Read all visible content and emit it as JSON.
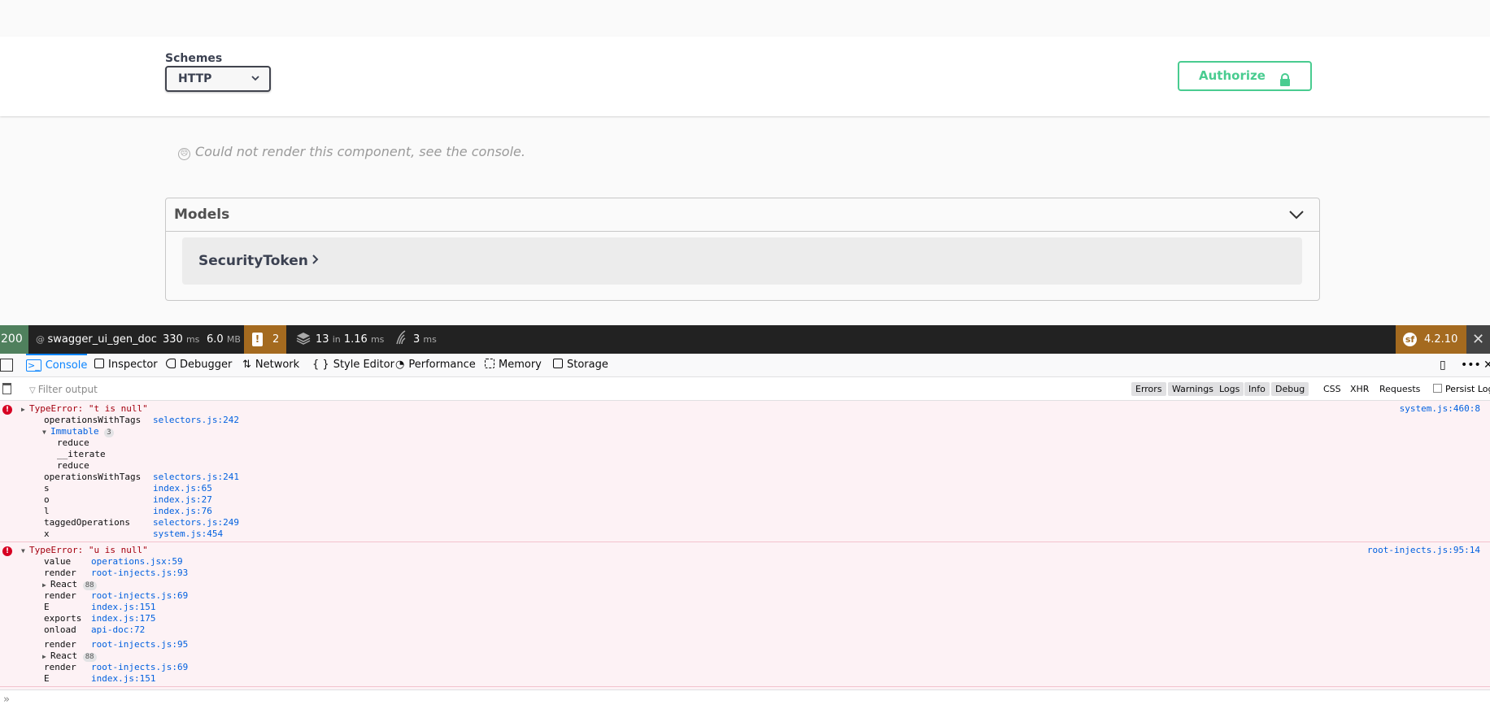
{
  "swagger": {
    "schemes_label": "Schemes",
    "scheme_selected": "HTTP",
    "authorize_label": "Authorize",
    "error_message": "Could not render this component, see the console.",
    "models_title": "Models",
    "model_name": "SecurityToken"
  },
  "symfony_toolbar": {
    "status_code": "200",
    "route": "swagger_ui_gen_doc",
    "time_value": "330",
    "time_unit": "ms",
    "memory_value": "6.0",
    "memory_unit": "MB",
    "warnings_count": "2",
    "db_queries": "13",
    "db_in": "in",
    "db_time": "1.16",
    "db_unit": "ms",
    "twig_time": "3",
    "twig_unit": "ms",
    "version": "4.2.10"
  },
  "devtools": {
    "tabs": [
      "Console",
      "Inspector",
      "Debugger",
      "Network",
      "Style Editor",
      "Performance",
      "Memory",
      "Storage"
    ],
    "filter_placeholder": "Filter output",
    "filter_buttons": [
      "Errors",
      "Warnings",
      "Logs",
      "Info",
      "Debug"
    ],
    "filter_text": [
      "CSS",
      "XHR",
      "Requests"
    ],
    "persist_label": "Persist Logs"
  },
  "console": {
    "error1": {
      "message": "TypeError: \"t is null\"",
      "source": "system.js:460:8",
      "stack": [
        {
          "fn": "operationsWithTags",
          "loc": "selectors.js:242"
        }
      ],
      "immutable_label": "Immutable",
      "immutable_count": "3",
      "immutable_items": [
        "reduce",
        "__iterate",
        "reduce"
      ],
      "stack2": [
        {
          "fn": "operationsWithTags",
          "loc": "selectors.js:241"
        },
        {
          "fn": "s",
          "loc": "index.js:65"
        },
        {
          "fn": "o",
          "loc": "index.js:27"
        },
        {
          "fn": "l",
          "loc": "index.js:76"
        },
        {
          "fn": "taggedOperations",
          "loc": "selectors.js:249"
        },
        {
          "fn": "x",
          "loc": "system.js:454"
        }
      ]
    },
    "error2": {
      "message": "TypeError: \"u is null\"",
      "source": "root-injects.js:95:14",
      "stack_a": [
        {
          "fn": "value",
          "loc": "operations.jsx:59"
        },
        {
          "fn": "render",
          "loc": "root-injects.js:93"
        }
      ],
      "react_label": "React",
      "react_count": "88",
      "stack_b": [
        {
          "fn": "render",
          "loc": "root-injects.js:69"
        },
        {
          "fn": "E",
          "loc": "index.js:151"
        },
        {
          "fn": "exports",
          "loc": "index.js:175"
        },
        {
          "fn": "onload",
          "loc": "api-doc:72"
        }
      ],
      "stack_c": [
        {
          "fn": "render",
          "loc": "root-injects.js:95"
        }
      ],
      "stack_d": [
        {
          "fn": "render",
          "loc": "root-injects.js:69"
        },
        {
          "fn": "E",
          "loc": "index.js:151"
        }
      ]
    }
  },
  "colors": {
    "authorize": "#49cc90",
    "status_ok": "#4f805d",
    "warn": "#a46a1f",
    "devtools_accent": "#0a84ff",
    "error_text": "#a4000f"
  }
}
